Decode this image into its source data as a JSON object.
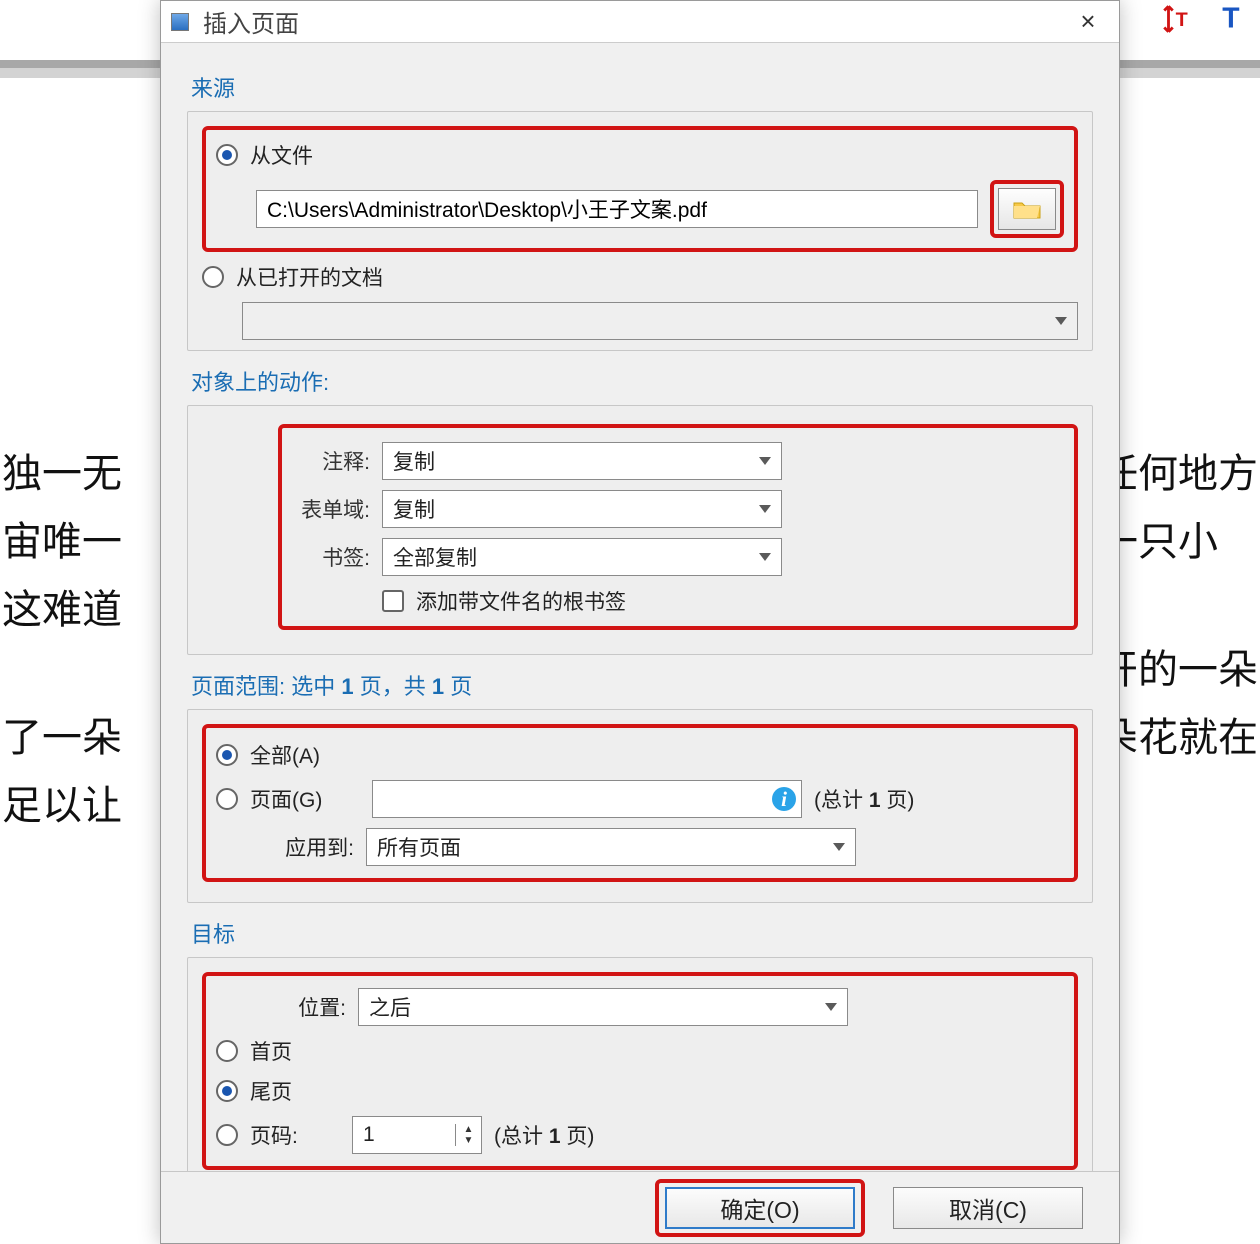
{
  "dialog": {
    "title": "插入页面",
    "close": "×"
  },
  "source": {
    "header": "来源",
    "from_file_label": "从文件",
    "file_path": "C:\\Users\\Administrator\\Desktop\\小王子文案.pdf",
    "from_open_docs_label": "从已打开的文档",
    "open_docs_value": ""
  },
  "actions": {
    "header": "对象上的动作:",
    "annot_label": "注释:",
    "annot_value": "复制",
    "form_label": "表单域:",
    "form_value": "复制",
    "bookmark_label": "书签:",
    "bookmark_value": "全部复制",
    "root_bookmark_label": "添加带文件名的根书签"
  },
  "range": {
    "header_prefix": "页面范围: 选中 ",
    "header_mid": " 页，共 ",
    "header_suffix": " 页",
    "selected": "1",
    "total": "1",
    "all_label": "全部(A)",
    "pages_label": "页面(G)",
    "pages_input": "",
    "total_text_prefix": "(总计 ",
    "total_text_num": "1",
    "total_text_suffix": " 页)",
    "apply_label": "应用到:",
    "apply_value": "所有页面"
  },
  "target": {
    "header": "目标",
    "position_label": "位置:",
    "position_value": "之后",
    "first_label": "首页",
    "last_label": "尾页",
    "pagenum_label": "页码:",
    "pagenum_value": "1",
    "total_text_prefix": "(总计 ",
    "total_text_num": "1",
    "total_text_suffix": " 页)"
  },
  "footer": {
    "ok": "确定(O)",
    "cancel": "取消(C)"
  },
  "bg": {
    "l1": "独一无",
    "l2": "宙唯一",
    "l3": "这难道",
    "l4": "了一朵",
    "l5": "足以让",
    "r1": "任何地方",
    "r2": "一只小",
    "r3": "",
    "r4": "开的一朵",
    "r5": "朵花就在"
  }
}
